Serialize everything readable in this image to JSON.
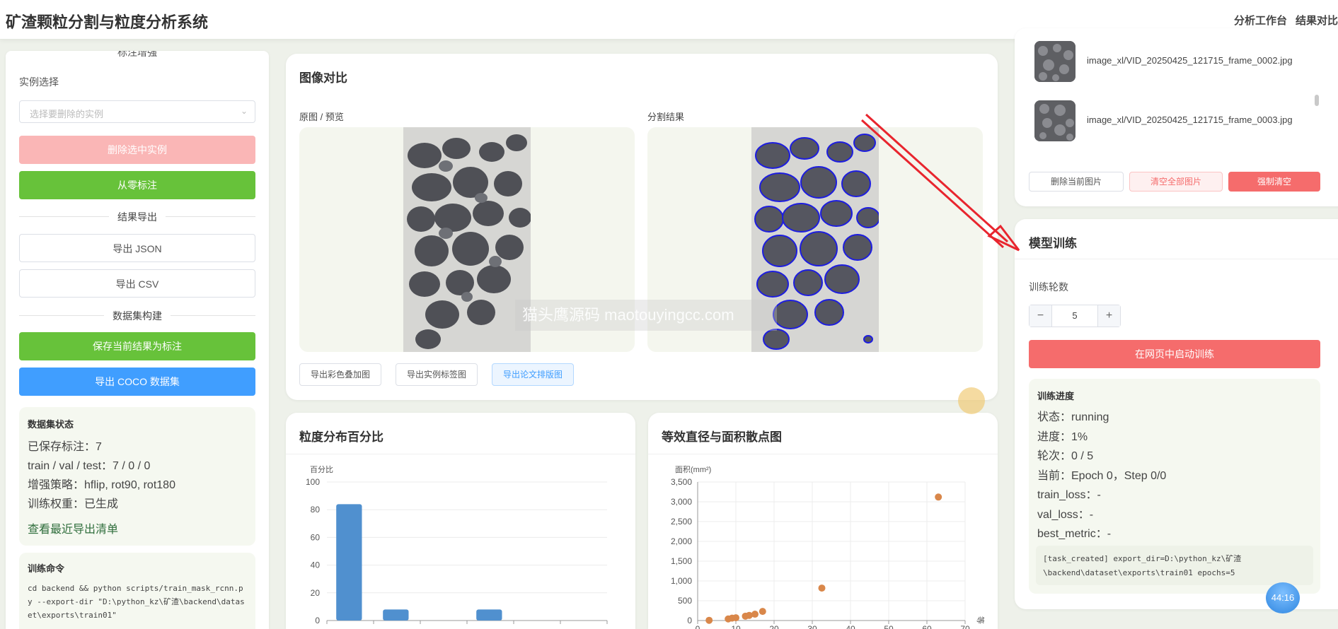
{
  "header": {
    "title": "矿渣颗粒分割与粒度分析系统",
    "nav": [
      "分析工作台",
      "结果对比"
    ]
  },
  "left_panel": {
    "top_clipped_heading": "标注增强",
    "instance_label": "实例选择",
    "instance_placeholder": "选择要删除的实例",
    "delete_instance_btn": "删除选中实例",
    "annotate_from_zero_btn": "从零标注",
    "export_section": "结果导出",
    "export_json_btn": "导出 JSON",
    "export_csv_btn": "导出 CSV",
    "dataset_section": "数据集构建",
    "save_annotation_btn": "保存当前结果为标注",
    "export_coco_btn": "导出 COCO 数据集",
    "dataset_status": {
      "heading": "数据集状态",
      "rows": [
        "已保存标注：7",
        "train / val / test：7 / 0 / 0",
        "增强策略：hflip, rot90, rot180",
        "训练权重：已生成"
      ],
      "link": "查看最近导出清单"
    },
    "train_cmd": {
      "heading": "训练命令",
      "code": "cd backend && python scripts/train_mask_rcnn.py --export-dir \"D:\\python_kz\\矿渣\\backend\\dataset\\exports\\train01\""
    }
  },
  "compare": {
    "title": "图像对比",
    "left_label": "原图 / 预览",
    "right_label": "分割结果",
    "buttons": [
      "导出彩色叠加图",
      "导出实例标签图",
      "导出论文排版图"
    ]
  },
  "watermark": "猫头鹰源码 maotouyingcc.com",
  "histogram": {
    "title": "粒度分布百分比"
  },
  "scatter": {
    "title": "等效直径与面积散点图"
  },
  "chart_data": [
    {
      "type": "bar",
      "title": "粒度分布百分比",
      "ylabel": "百分比",
      "ylim": [
        0,
        100
      ],
      "yticks": [
        0,
        20,
        40,
        60,
        80,
        100
      ],
      "values": [
        84,
        8,
        0,
        8,
        0,
        0
      ],
      "color": "#5090cf",
      "grid": true
    },
    {
      "type": "scatter",
      "title": "等效直径与面积散点图",
      "ylabel": "面积(mm²)",
      "xlabel": "等",
      "xlim": [
        0,
        70
      ],
      "ylim": [
        0,
        3500
      ],
      "xticks": [
        0,
        10,
        20,
        30,
        40,
        50,
        60,
        70
      ],
      "yticks": [
        0,
        500,
        1000,
        1500,
        2000,
        2500,
        3000,
        3500
      ],
      "ytick_labels": [
        "0",
        "500",
        "1,000",
        "1,500",
        "2,000",
        "2,500",
        "3,000",
        "3,500"
      ],
      "x": [
        3,
        8,
        9,
        10,
        12.5,
        13.5,
        15,
        17,
        32.5,
        63
      ],
      "y": [
        5,
        40,
        60,
        70,
        110,
        130,
        160,
        230,
        820,
        3120
      ],
      "color": "#d9874a",
      "grid": true
    }
  ],
  "files": {
    "items": [
      "image_xl/VID_20250425_121715_frame_0002.jpg",
      "image_xl/VID_20250425_121715_frame_0003.jpg"
    ],
    "delete_current": "删除当前图片",
    "clear_all": "清空全部图片",
    "force_clear": "强制清空"
  },
  "training": {
    "title": "模型训练",
    "epochs_label": "训练轮数",
    "epochs_value": "5",
    "start_btn": "在网页中启动训练",
    "progress": {
      "heading": "训练进度",
      "rows": [
        "状态：running",
        "进度：1%",
        "轮次：0 / 5",
        "当前：Epoch 0，Step 0/0",
        "train_loss：-",
        "val_loss：-",
        "best_metric：-"
      ],
      "log": "[task_created] export_dir=D:\\python_kz\\矿渣\\backend\\dataset\\exports\\train01 epochs=5"
    }
  },
  "timer": "44:16",
  "colors": {
    "green": "#67c23a",
    "blue": "#409eff",
    "pink": "#fab6b6",
    "red": "#f56c6c",
    "arrow": "#e8252e"
  }
}
